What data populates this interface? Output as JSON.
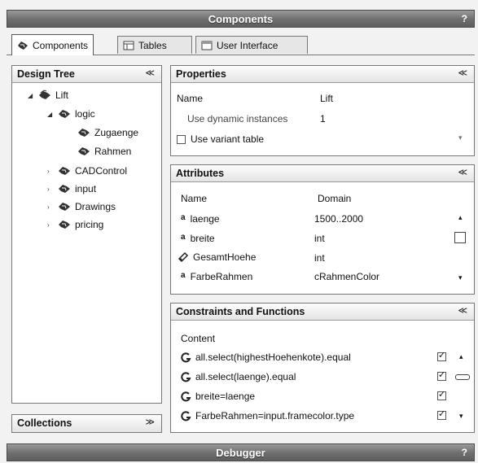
{
  "window": {
    "title": "Components",
    "help": "?"
  },
  "tabs": [
    {
      "label": "Components",
      "active": true
    },
    {
      "label": "Tables",
      "active": false
    },
    {
      "label": "User Interface",
      "active": false
    }
  ],
  "design_tree": {
    "title": "Design Tree",
    "collapse_glyph": "≪",
    "nodes": [
      {
        "label": "Lift",
        "expanded": true
      },
      {
        "label": "logic",
        "expanded": true
      },
      {
        "label": "Zugaenge"
      },
      {
        "label": "Rahmen"
      },
      {
        "label": "CADControl"
      },
      {
        "label": "input"
      },
      {
        "label": "Drawings"
      },
      {
        "label": "pricing"
      }
    ]
  },
  "collections": {
    "title": "Collections",
    "expand_glyph": "≫"
  },
  "properties": {
    "title": "Properties",
    "name_label": "Name",
    "name_value": "Lift",
    "dynamic_label": "Use dynamic instances",
    "dynamic_value": "1",
    "variant_label": "Use variant table"
  },
  "attributes": {
    "title": "Attributes",
    "col_name": "Name",
    "col_domain": "Domain",
    "rows": [
      {
        "name": "laenge",
        "domain": "1500..2000"
      },
      {
        "name": "breite",
        "domain": "int"
      },
      {
        "name": "GesamtHoehe",
        "domain": "int"
      },
      {
        "name": "FarbeRahmen",
        "domain": "cRahmenColor"
      }
    ]
  },
  "constraints": {
    "title": "Constraints and Functions",
    "col_content": "Content",
    "rows": [
      {
        "content": "all.select(highestHoehenkote).equal",
        "checked": true
      },
      {
        "content": "all.select(laenge).equal",
        "checked": true
      },
      {
        "content": "breite=laenge",
        "checked": true
      },
      {
        "content": "FarbeRahmen=input.framecolor.type",
        "checked": true
      }
    ]
  },
  "debugger": {
    "title": "Debugger",
    "help": "?"
  }
}
